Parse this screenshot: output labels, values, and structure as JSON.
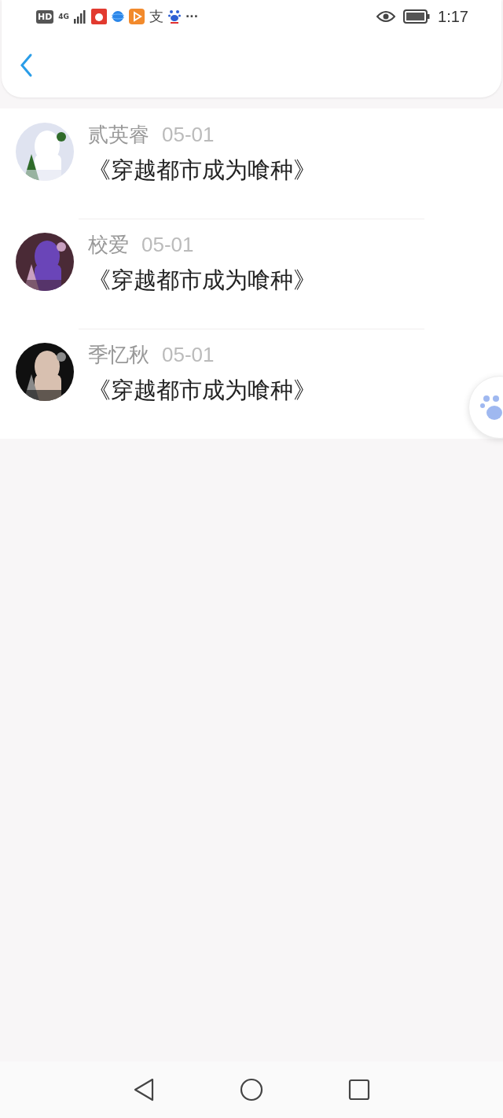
{
  "status_bar": {
    "hd": "HD",
    "network": "4G",
    "app_glyph": "支",
    "more": "···",
    "time": "1:17"
  },
  "comments": [
    {
      "name": "贰英睿",
      "date": "05-01",
      "text": "《穿越都市成为喰种》"
    },
    {
      "name": "校爱",
      "date": "05-01",
      "text": "《穿越都市成为喰种》"
    },
    {
      "name": "季忆秋",
      "date": "05-01",
      "text": "《穿越都市成为喰种》"
    }
  ]
}
